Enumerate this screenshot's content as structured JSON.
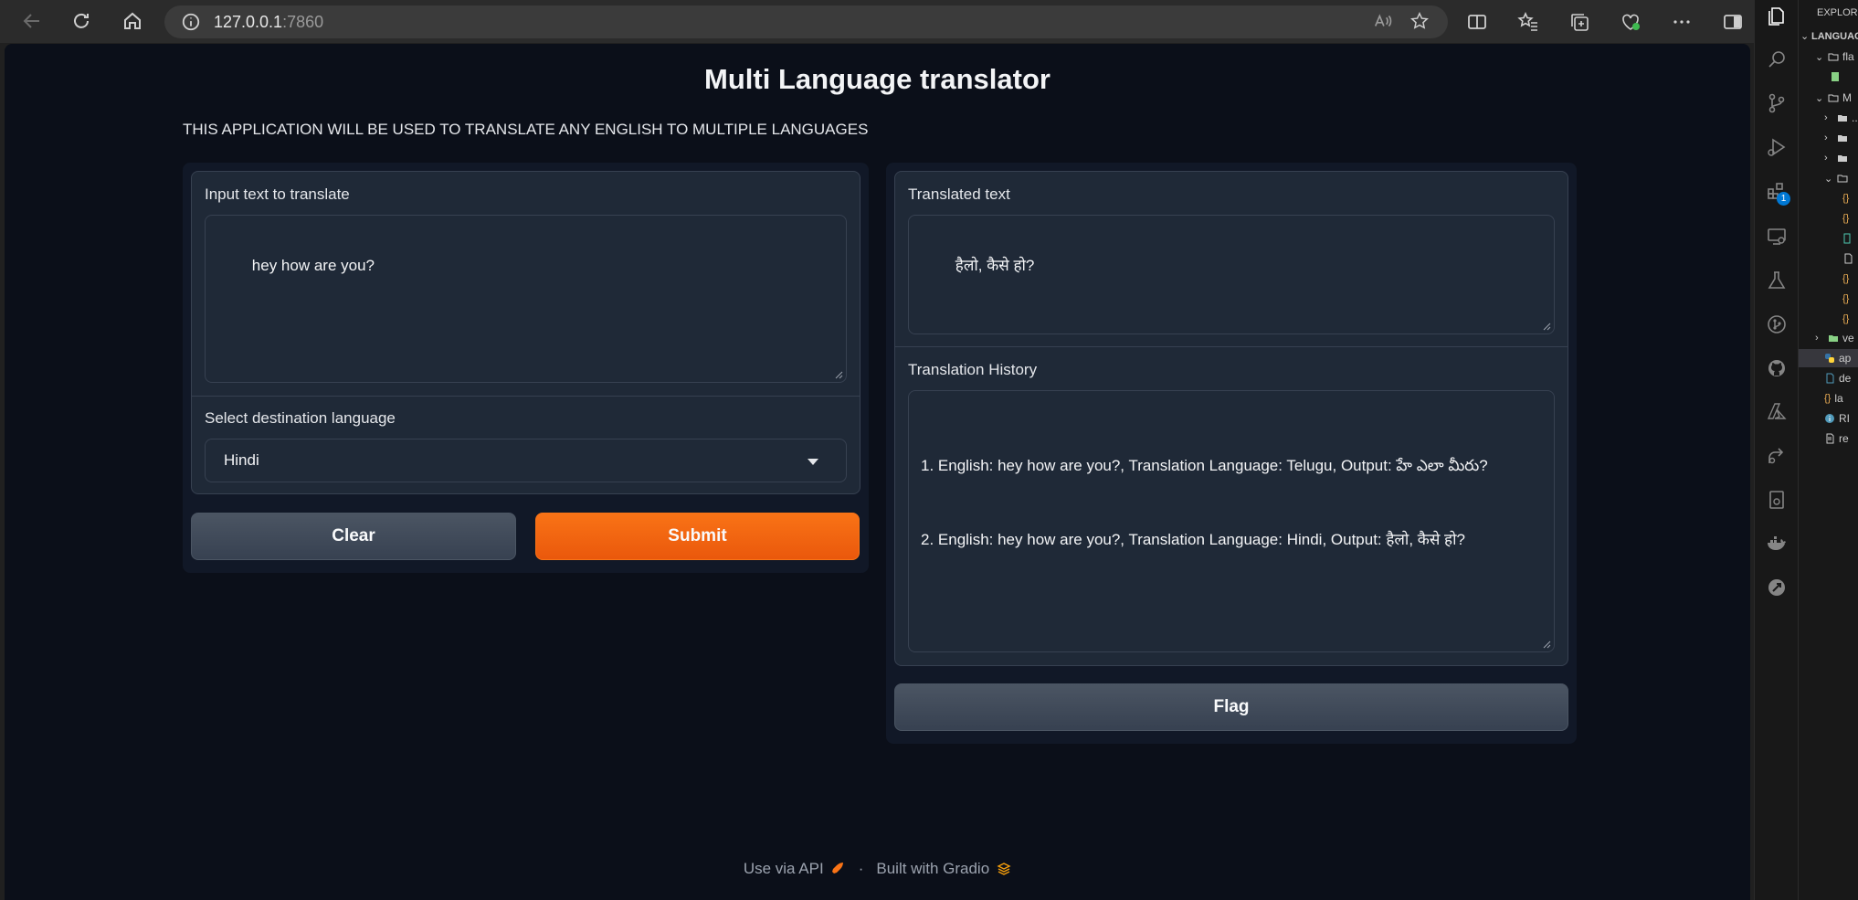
{
  "browser": {
    "url_host": "127.0.0.1",
    "url_port": ":7860"
  },
  "app": {
    "title": "Multi Language translator",
    "description": "THIS APPLICATION WILL BE USED TO TRANSLATE ANY ENGLISH TO MULTIPLE LANGUAGES"
  },
  "inputs": {
    "text_label": "Input text to translate",
    "text_value": "hey how are you?",
    "language_label": "Select destination language",
    "language_value": "Hindi"
  },
  "buttons": {
    "clear": "Clear",
    "submit": "Submit",
    "flag": "Flag"
  },
  "outputs": {
    "translated_label": "Translated text",
    "translated_value": "हैलो, कैसे हो?",
    "history_label": "Translation History",
    "history_lines": [
      "1. English: hey how are you?, Translation Language: Telugu, Output: హే ఎలా మీరు?",
      "2. English: hey how are you?, Translation Language: Hindi, Output: हैलो, कैसे हो?"
    ]
  },
  "footer": {
    "api": "Use via API",
    "separator": "·",
    "built": "Built with Gradio"
  },
  "vscode": {
    "explorer_title": "EXPLORER",
    "workspace": "LANGUAGE",
    "tree": [
      {
        "label": "fla",
        "kind": "folder-open",
        "indent": 0
      },
      {
        "label": "",
        "kind": "file-green",
        "indent": 1
      },
      {
        "label": "M",
        "kind": "folder-open",
        "indent": 0
      },
      {
        "label": "..",
        "kind": "folder-closed",
        "indent": 1
      },
      {
        "label": "",
        "kind": "folder-closed",
        "indent": 1
      },
      {
        "label": "",
        "kind": "folder-closed",
        "indent": 1
      },
      {
        "label": "",
        "kind": "folder-open",
        "indent": 1
      },
      {
        "label": "",
        "kind": "json",
        "indent": 2
      },
      {
        "label": "",
        "kind": "json",
        "indent": 2
      },
      {
        "label": "",
        "kind": "file-teal",
        "indent": 2
      },
      {
        "label": "",
        "kind": "file",
        "indent": 2
      },
      {
        "label": "",
        "kind": "json",
        "indent": 2
      },
      {
        "label": "",
        "kind": "json",
        "indent": 2
      },
      {
        "label": "",
        "kind": "json",
        "indent": 2
      },
      {
        "label": "ve",
        "kind": "folder-green",
        "indent": 0
      },
      {
        "label": "ap",
        "kind": "python",
        "indent": 0
      },
      {
        "label": "de",
        "kind": "file-blue",
        "indent": 0
      },
      {
        "label": "la",
        "kind": "json",
        "indent": 0
      },
      {
        "label": "RI",
        "kind": "info",
        "indent": 0
      },
      {
        "label": "re",
        "kind": "file",
        "indent": 0
      }
    ],
    "badge": "1"
  },
  "colors": {
    "accent_orange": "#f97316",
    "bg_dark": "#0b0f19",
    "panel": "#1f2937"
  }
}
